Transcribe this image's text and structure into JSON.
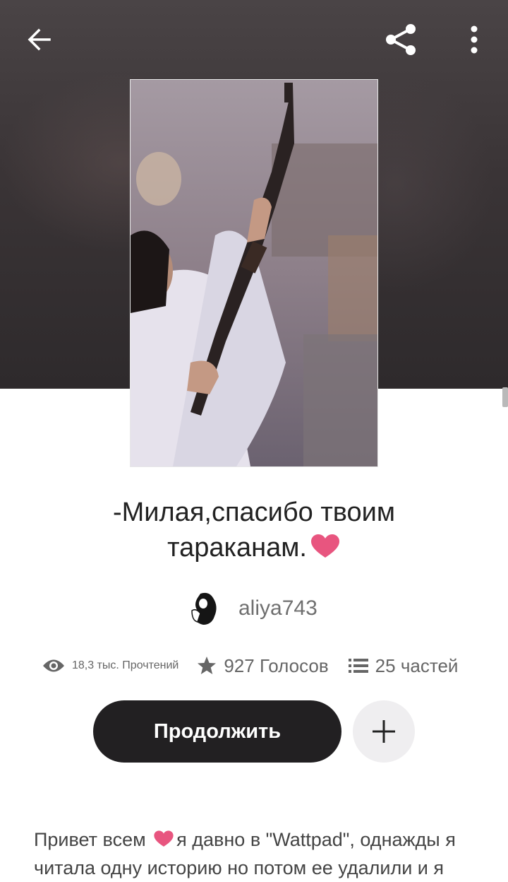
{
  "header": {
    "back_icon": "arrow-left-icon",
    "share_icon": "share-icon",
    "more_icon": "more-vertical-icon"
  },
  "story": {
    "title": "-Милая,спасибо твоим тараканам.",
    "title_emoji": "heart-emoji",
    "author": "aliya743",
    "cover_description_icon": "book-cover-image"
  },
  "stats": {
    "reads": "18,3 тыс. Прочтений",
    "votes": "927 Голосов",
    "parts": "25 частей"
  },
  "actions": {
    "continue_label": "Продолжить",
    "add_icon": "plus-icon"
  },
  "description": {
    "before_heart": "Привет всем ",
    "after_heart": "я давно в \"Wattpad\", однажды я читала одну историю но потом ее удалили и я"
  },
  "colors": {
    "accent_dark": "#222022",
    "heart_pink": "#e8557f",
    "hero_bg": "#3a3436"
  }
}
